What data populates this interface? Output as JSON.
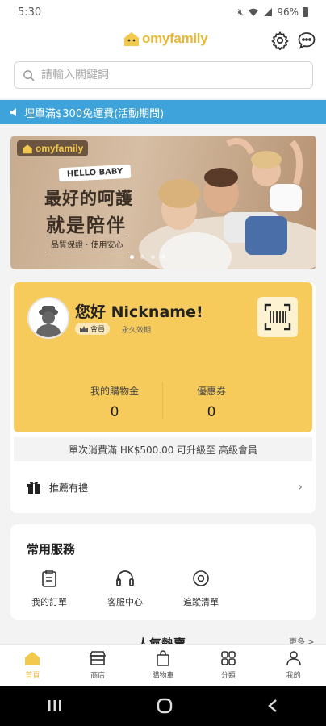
{
  "status_bar": {
    "time": "5:30",
    "battery": "96%"
  },
  "header": {
    "logo_text": "omyfamily",
    "colors": {
      "brand": "#e8b83a",
      "accent_blue": "#3ea3da"
    }
  },
  "search": {
    "placeholder": "請輸入關鍵詞"
  },
  "announcement": {
    "text": "埋單滿$300免運費(活動期間)"
  },
  "banner": {
    "logo_text": "omyfamily",
    "tag": "HELLO BABY",
    "line1": "最好的呵護",
    "line2": "就是陪伴",
    "subline": "品質保證 · 使用安心",
    "slide_count": 4,
    "active_slide": 1
  },
  "member": {
    "greeting": "您好 Nickname!",
    "badge": "會員",
    "validity": "永久效期",
    "stats": [
      {
        "label": "我的購物金",
        "value": "0"
      },
      {
        "label": "優惠券",
        "value": "0"
      }
    ],
    "upgrade_text": "單次消費滿 HK$500.00 可升級至 高級會員",
    "referral_label": "推薦有禮"
  },
  "services": {
    "title": "常用服務",
    "items": [
      {
        "label": "我的訂單",
        "icon": "order-icon"
      },
      {
        "label": "客服中心",
        "icon": "headset-icon"
      },
      {
        "label": "追蹤清單",
        "icon": "track-icon"
      }
    ]
  },
  "next_section": {
    "title": "人氣熱賣",
    "more": "更多 >"
  },
  "bottom_nav": [
    {
      "label": "首頁",
      "icon": "home-icon",
      "active": true
    },
    {
      "label": "商店",
      "icon": "store-icon"
    },
    {
      "label": "購物車",
      "icon": "cart-icon"
    },
    {
      "label": "分類",
      "icon": "category-icon"
    },
    {
      "label": "我的",
      "icon": "profile-icon"
    }
  ]
}
